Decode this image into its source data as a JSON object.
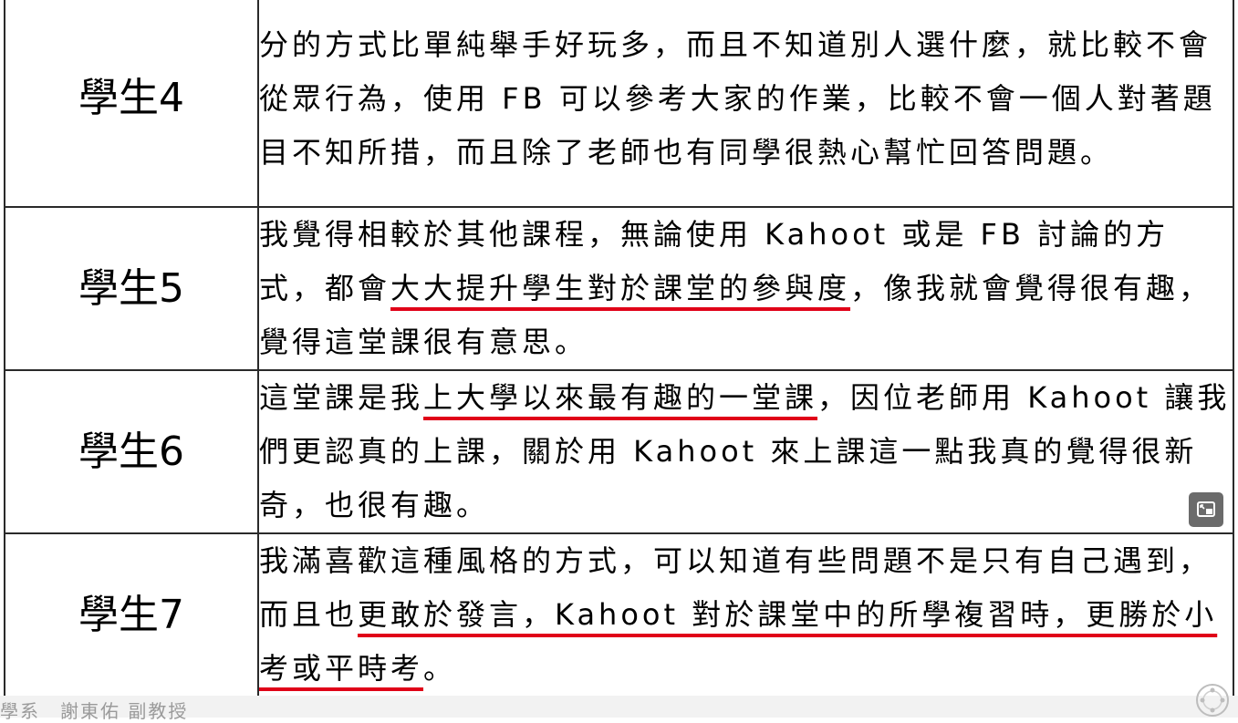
{
  "rows": [
    {
      "label": "學生4",
      "segments": [
        {
          "text": "分的方式比單純舉手好玩多，而且不知道別人選什麼，就比較不會從眾行為，使用 FB 可以參考大家的作業，比較不會一個人對著題目不知所措，而且除了老師也有同學很熱心幫忙回答問題。",
          "underline": false
        }
      ]
    },
    {
      "label": "學生5",
      "segments": [
        {
          "text": "我覺得相較於其他課程，無論使用 Kahoot 或是 FB 討論的方式，都會",
          "underline": false
        },
        {
          "text": "大大提升學生對於課堂的參與度",
          "underline": true
        },
        {
          "text": "，像我就會覺得很有趣，覺得這堂課很有意思。",
          "underline": false
        }
      ]
    },
    {
      "label": "學生6",
      "segments": [
        {
          "text": "這堂課是我",
          "underline": false
        },
        {
          "text": "上大學以來最有趣的一堂課",
          "underline": true
        },
        {
          "text": "，因位老師用 Kahoot 讓我們更認真的上課，關於用 Kahoot 來上課這一點我真的覺得很新奇，也很有趣。",
          "underline": false
        }
      ]
    },
    {
      "label": "學生7",
      "segments": [
        {
          "text": "我滿喜歡這種風格的方式，可以知道有些問題不是只有自己遇到，而且也",
          "underline": false
        },
        {
          "text": "更敢於發言，Kahoot 對於課堂中的所學複習時，更勝於小考或平時考",
          "underline": true
        },
        {
          "text": "。",
          "underline": false
        }
      ]
    }
  ],
  "footer": {
    "text": "學系　謝東佑 副教授"
  },
  "icons": {
    "pip": "picture-in-picture-icon",
    "watermark": "watermark-logo-icon"
  },
  "colors": {
    "underline": "#e00018",
    "border": "#2a2a2a"
  }
}
